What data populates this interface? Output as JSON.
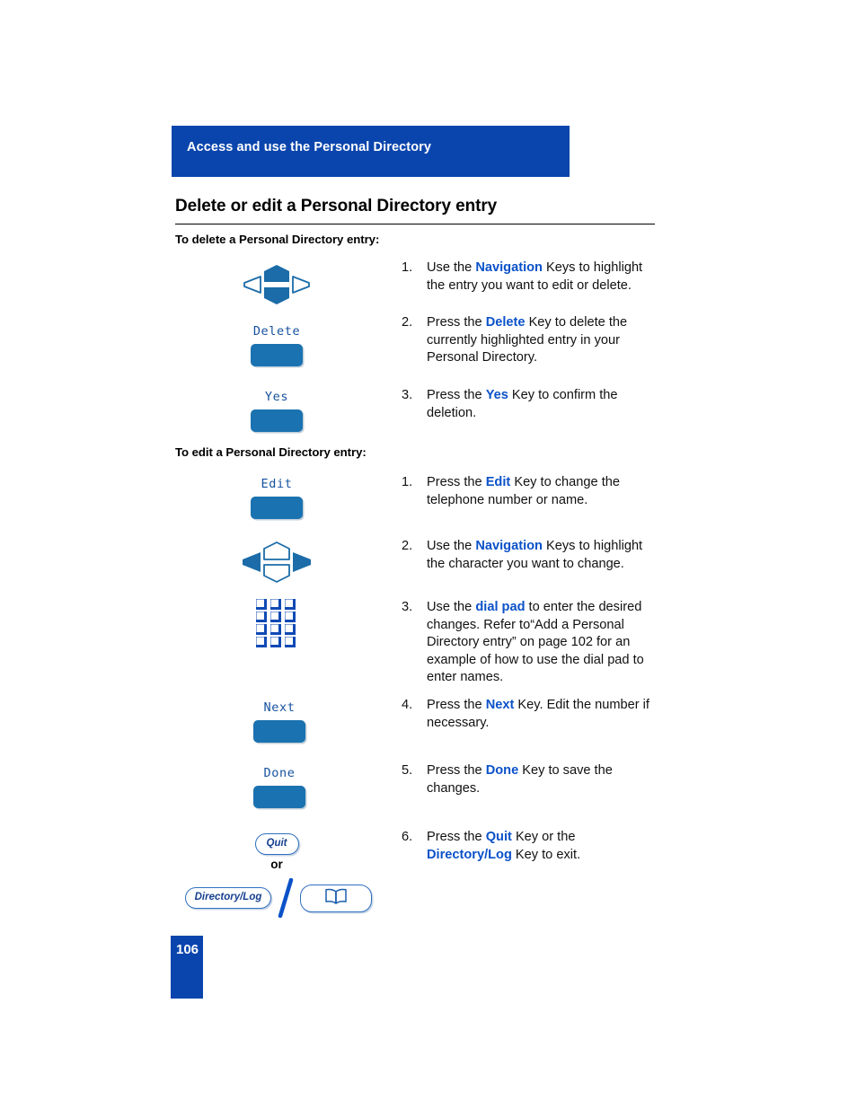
{
  "banner": {
    "title": "Access and use the Personal Directory"
  },
  "heading": {
    "title": "Delete or edit a Personal Directory entry"
  },
  "subheadings": {
    "delete": "To delete a Personal Directory entry:",
    "edit": "To edit a Personal Directory entry:"
  },
  "delete_steps": [
    {
      "num": "1.",
      "pre": "Use the ",
      "kw": "Navigation",
      "post": " Keys to highlight the entry you want to edit or delete."
    },
    {
      "num": "2.",
      "pre": "Press the ",
      "kw": "Delete",
      "post": " Key to delete the currently highlighted entry in your Personal Directory."
    },
    {
      "num": "3.",
      "pre": "Press the ",
      "kw": "Yes",
      "post": " Key to confirm the deletion."
    }
  ],
  "edit_steps": [
    {
      "num": "1.",
      "pre": "Press the ",
      "kw": "Edit",
      "post": " Key to change the telephone number or name."
    },
    {
      "num": "2.",
      "pre": "Use the ",
      "kw": "Navigation",
      "post": " Keys to highlight the character you want to change."
    },
    {
      "num": "3.",
      "pre": "Use the ",
      "kw": "dial pad",
      "post": " to enter the desired changes. Refer to“Add a Personal Directory entry” on page 102 for an example of how to use the dial pad to enter names."
    },
    {
      "num": "4.",
      "pre": "Press the ",
      "kw": "Next",
      "post": " Key. Edit the number if necessary."
    },
    {
      "num": "5.",
      "pre": "Press the ",
      "kw": "Done",
      "post": " Key to save the changes."
    },
    {
      "num": "6.",
      "pre": "Press  the ",
      "kw": "Quit",
      "post": " Key or the ",
      "kw2": "Directory/Log",
      "post2": " Key to exit."
    }
  ],
  "softkeys": {
    "delete": "Delete",
    "yes": "Yes",
    "edit": "Edit",
    "next": "Next",
    "done": "Done"
  },
  "hardkeys": {
    "quit": "Quit",
    "directory_log": "Directory/Log",
    "or": "or"
  },
  "icons": {
    "navigation_updown": "navigation-keys-updown-icon",
    "navigation_leftright": "navigation-keys-leftright-icon",
    "dial_pad": "dial-pad-icon",
    "book": "directory-book-icon",
    "slash": "or-slash-icon"
  },
  "footer": {
    "page_number": "106"
  },
  "colors": {
    "banner_blue": "#0a45ad",
    "keyword_blue": "#0b52c8",
    "softkey_blue": "#1b72b0",
    "lcd_label_blue": "#15519e",
    "hardkey_border": "#2f6fc0",
    "hardkey_text": "#17408f"
  }
}
